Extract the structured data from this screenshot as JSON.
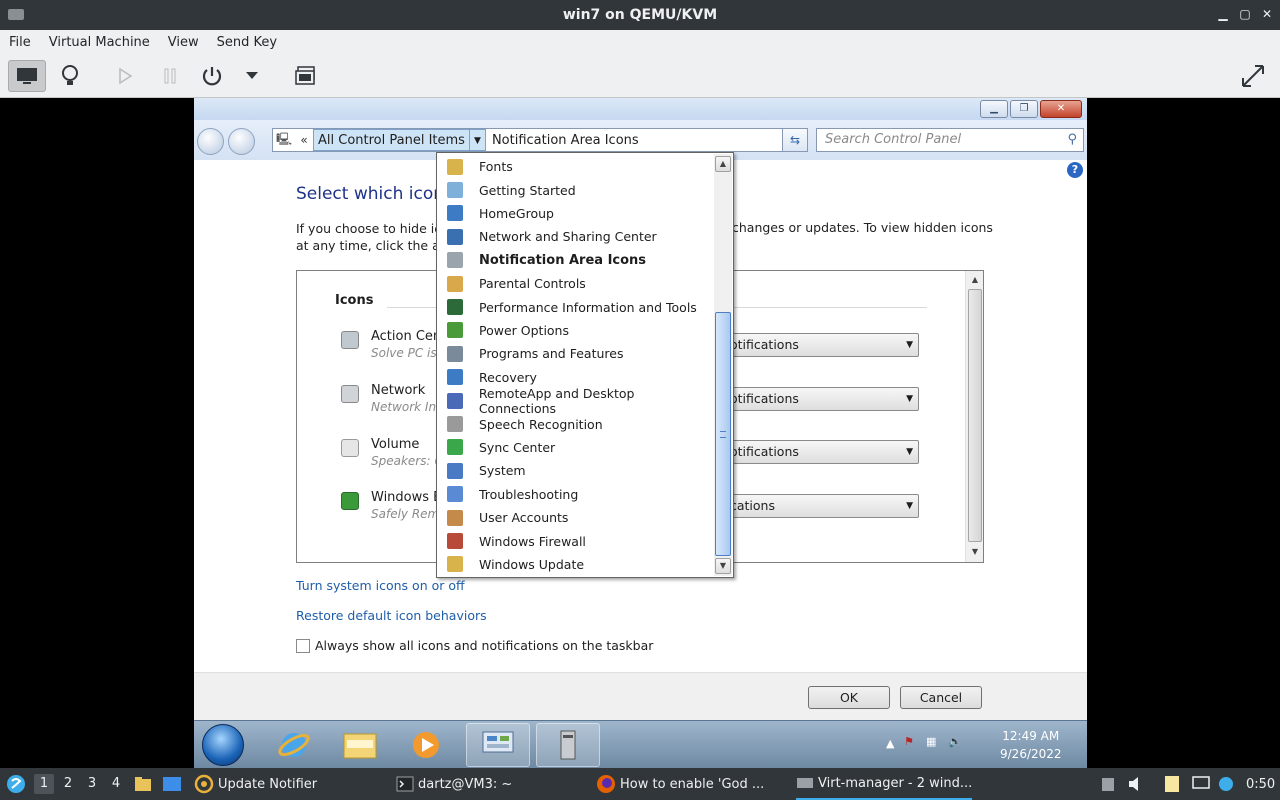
{
  "host": {
    "title": "win7 on QEMU/KVM",
    "menu": [
      "File",
      "Virtual Machine",
      "View",
      "Send Key"
    ]
  },
  "address": {
    "segment": "All Control Panel Items",
    "current": "Notification Area Icons",
    "search_placeholder": "Search Control Panel"
  },
  "page": {
    "heading": "Select which icons",
    "heading_tail": "r",
    "desc_line1": "If you choose to hide ic",
    "desc_line2": "at any time, click the ar",
    "desc_right": "changes or updates. To view hidden icons",
    "icons_header": "Icons",
    "rows": [
      {
        "name": "Action Cen",
        "sub": "Solve PC is",
        "behavior": "otifications"
      },
      {
        "name": "Network",
        "sub": "Network In",
        "behavior": "otifications"
      },
      {
        "name": "Volume",
        "sub": "Speakers: 6",
        "behavior": "otifications"
      },
      {
        "name": "Windows E",
        "sub": "Safely Rem",
        "behavior": "cations"
      }
    ],
    "link1": "Turn system icons on or off",
    "link2": "Restore default icon behaviors",
    "always_show": "Always show all icons and notifications on the taskbar",
    "ok": "OK",
    "cancel": "Cancel"
  },
  "dropdown": {
    "items": [
      {
        "label": "Fonts",
        "color": "#d8b24a"
      },
      {
        "label": "Getting Started",
        "color": "#7fb0d9"
      },
      {
        "label": "HomeGroup",
        "color": "#3d7cc4"
      },
      {
        "label": "Network and Sharing Center",
        "color": "#3a6fb0"
      },
      {
        "label": "Notification Area Icons",
        "color": "#9aa4ad",
        "bold": true
      },
      {
        "label": "Parental Controls",
        "color": "#d9a84a"
      },
      {
        "label": "Performance Information and Tools",
        "color": "#2d6a3a"
      },
      {
        "label": "Power Options",
        "color": "#4a9a3a"
      },
      {
        "label": "Programs and Features",
        "color": "#7a8a9a"
      },
      {
        "label": "Recovery",
        "color": "#3d7cc4"
      },
      {
        "label": "RemoteApp and Desktop Connections",
        "color": "#4a6ab8"
      },
      {
        "label": "Speech Recognition",
        "color": "#9a9a9a"
      },
      {
        "label": "Sync Center",
        "color": "#3aa84a"
      },
      {
        "label": "System",
        "color": "#4a7ac4"
      },
      {
        "label": "Troubleshooting",
        "color": "#5a8ad4"
      },
      {
        "label": "User Accounts",
        "color": "#c48a4a"
      },
      {
        "label": "Windows Firewall",
        "color": "#b84a3a"
      },
      {
        "label": "Windows Update",
        "color": "#d8b24a"
      }
    ]
  },
  "win7_taskbar": {
    "time": "12:49 AM",
    "date": "9/26/2022"
  },
  "host_taskbar": {
    "workspaces": [
      "1",
      "2",
      "3",
      "4"
    ],
    "tasks": [
      "Update Notifier",
      "dartz@VM3: ~",
      "How to enable 'God ...",
      "Virt-manager - 2 wind..."
    ],
    "clock": "0:50"
  }
}
